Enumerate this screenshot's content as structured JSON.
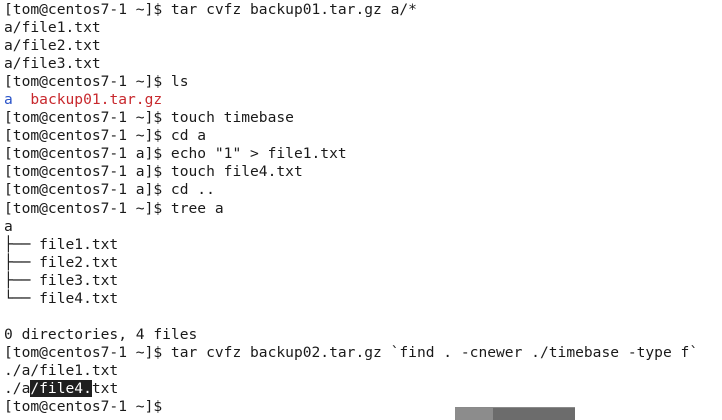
{
  "terminal": {
    "lines": [
      [
        {
          "text": "[tom@centos7-1 ~]$ tar cvfz backup01.tar.gz a/*",
          "style": ""
        }
      ],
      [
        {
          "text": "a/file1.txt",
          "style": ""
        }
      ],
      [
        {
          "text": "a/file2.txt",
          "style": ""
        }
      ],
      [
        {
          "text": "a/file3.txt",
          "style": ""
        }
      ],
      [
        {
          "text": "[tom@centos7-1 ~]$ ls",
          "style": ""
        }
      ],
      [
        {
          "text": "a",
          "style": "dir"
        },
        {
          "text": "  ",
          "style": ""
        },
        {
          "text": "backup01.tar.gz",
          "style": "archive"
        }
      ],
      [
        {
          "text": "[tom@centos7-1 ~]$ touch timebase",
          "style": ""
        }
      ],
      [
        {
          "text": "[tom@centos7-1 ~]$ cd a",
          "style": ""
        }
      ],
      [
        {
          "text": "[tom@centos7-1 a]$ echo \"1\" > file1.txt",
          "style": ""
        }
      ],
      [
        {
          "text": "[tom@centos7-1 a]$ touch file4.txt",
          "style": ""
        }
      ],
      [
        {
          "text": "[tom@centos7-1 a]$ cd ..",
          "style": ""
        }
      ],
      [
        {
          "text": "[tom@centos7-1 ~]$ tree a",
          "style": ""
        }
      ],
      [
        {
          "text": "a",
          "style": ""
        }
      ],
      [
        {
          "text": "├── file1.txt",
          "style": ""
        }
      ],
      [
        {
          "text": "├── file2.txt",
          "style": ""
        }
      ],
      [
        {
          "text": "├── file3.txt",
          "style": ""
        }
      ],
      [
        {
          "text": "└── file4.txt",
          "style": ""
        }
      ],
      [
        {
          "text": "",
          "style": ""
        }
      ],
      [
        {
          "text": "0 directories, 4 files",
          "style": ""
        }
      ],
      [
        {
          "text": "[tom@centos7-1 ~]$ tar cvfz backup02.tar.gz `find . -cnewer ./timebase -type f`",
          "style": ""
        }
      ],
      [
        {
          "text": "./a/file1.txt",
          "style": ""
        }
      ],
      [
        {
          "text": "./a",
          "style": ""
        },
        {
          "text": "/file4.",
          "style": "selected"
        },
        {
          "text": "txt",
          "style": ""
        }
      ],
      [
        {
          "text": "[tom@centos7-1 ~]$ ",
          "style": ""
        }
      ]
    ]
  },
  "colors": {
    "background": "#ffffff",
    "text": "#1a1a1a",
    "directory": "#2b54c9",
    "archive": "#c8282d",
    "selection_bg": "#1f1f1f",
    "selection_fg": "#ffffff"
  }
}
